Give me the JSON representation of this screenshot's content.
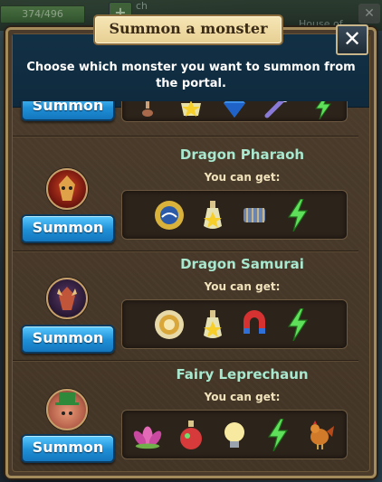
{
  "background": {
    "counter": "374/496",
    "plus": "+",
    "partial_label": "ch",
    "partial_house": "House of",
    "close": "✕"
  },
  "dialog": {
    "title": "Summon a monster",
    "description": "Choose which monster you want to summon from the portal.",
    "close_label": "✕"
  },
  "monsters": [
    {
      "name": "",
      "you_can_get": "",
      "summon_label": "Summon",
      "rewards": [
        "potion-icon",
        "star-icon",
        "diamond-icon",
        "wand-icon",
        "lightning-icon"
      ]
    },
    {
      "name": "Dragon Pharaoh",
      "you_can_get": "You can get:",
      "summon_label": "Summon",
      "rewards": [
        "sun-medallion-icon",
        "star-potion-icon",
        "scroll-cage-icon",
        "lightning-icon"
      ]
    },
    {
      "name": "Dragon Samurai",
      "you_can_get": "You can get:",
      "summon_label": "Summon",
      "rewards": [
        "gold-coin-icon",
        "star-potion-icon",
        "magnet-icon",
        "lightning-icon"
      ]
    },
    {
      "name": "Fairy Leprechaun",
      "you_can_get": "You can get:",
      "summon_label": "Summon",
      "rewards": [
        "lotus-flower-icon",
        "red-potion-icon",
        "light-bulb-icon",
        "lightning-icon",
        "rooster-icon"
      ]
    }
  ],
  "colors": {
    "summon_button": "#1e8fd6",
    "monster_name": "#a8e8cf",
    "header_band": "#123045",
    "panel_border": "#a48b5c"
  }
}
